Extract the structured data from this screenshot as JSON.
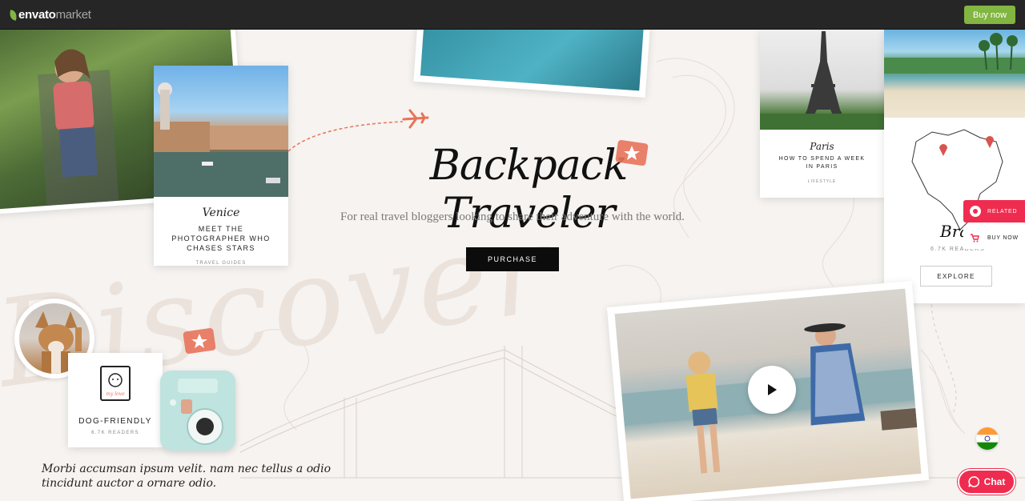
{
  "topbar": {
    "logo_bold": "envato",
    "logo_light": "market",
    "buy_label": "Buy now"
  },
  "hero": {
    "title": "Backpack Traveler",
    "subtitle": "For real travel bloggers looking to share their adventure with the world.",
    "purchase_label": "PURCHASE",
    "discover": "Discover"
  },
  "venice": {
    "script": "Venice",
    "title": "MEET THE PHOTOGRAPHER WHO CHASES STARS",
    "category": "TRAVEL GUIDES"
  },
  "paris": {
    "script": "Paris",
    "title": "HOW TO SPEND A WEEK IN PARIS",
    "category": "LIFESTYLE"
  },
  "brazil": {
    "script": "Bra",
    "readers": "6.7K READERS",
    "explore_label": "EXPLORE"
  },
  "side": {
    "related_label": "RELATED",
    "buy_label": "BUY NOW"
  },
  "dog": {
    "title": "DOG-FRIENDLY",
    "readers": "6.7K READERS",
    "icon_text": "my love"
  },
  "note": {
    "line1": "Morbi accumsan ipsum velit. nam nec tellus a odio",
    "line2": "tincidunt auctor a ornare odio."
  },
  "chat": {
    "label": "Chat"
  },
  "colors": {
    "accent": "#ef2c4f",
    "envato_green": "#82b541",
    "topbar": "#262626",
    "stamp": "#e8735a"
  }
}
